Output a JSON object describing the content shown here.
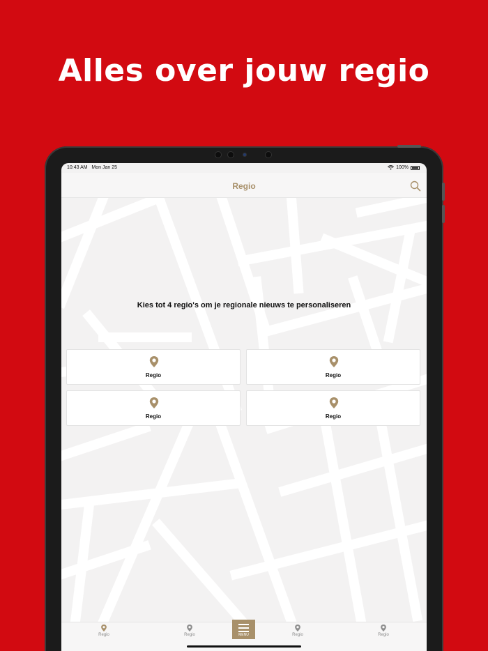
{
  "headline": "Alles over jouw regio",
  "status": {
    "time": "10:43 AM",
    "date": "Mon Jan 25",
    "battery": "100%"
  },
  "nav": {
    "title": "Regio"
  },
  "icons": {
    "search": "search-icon",
    "pin": "location-pin-icon",
    "menu": "hamburger-menu-icon",
    "wifi": "wifi-icon",
    "battery": "battery-icon"
  },
  "intro": "Kies tot 4 regio's om je regionale nieuws te personaliseren",
  "cards": [
    {
      "label": "Regio"
    },
    {
      "label": "Regio"
    },
    {
      "label": "Regio"
    },
    {
      "label": "Regio"
    }
  ],
  "tabbar": {
    "tabs": [
      {
        "label": "Regio"
      },
      {
        "label": "Regio"
      },
      {
        "label": "Regio"
      },
      {
        "label": "Regio"
      }
    ],
    "menu_label": "MENU"
  },
  "colors": {
    "background": "#D20A11",
    "accent": "#A8906A",
    "screen": "#F3F2F2"
  }
}
